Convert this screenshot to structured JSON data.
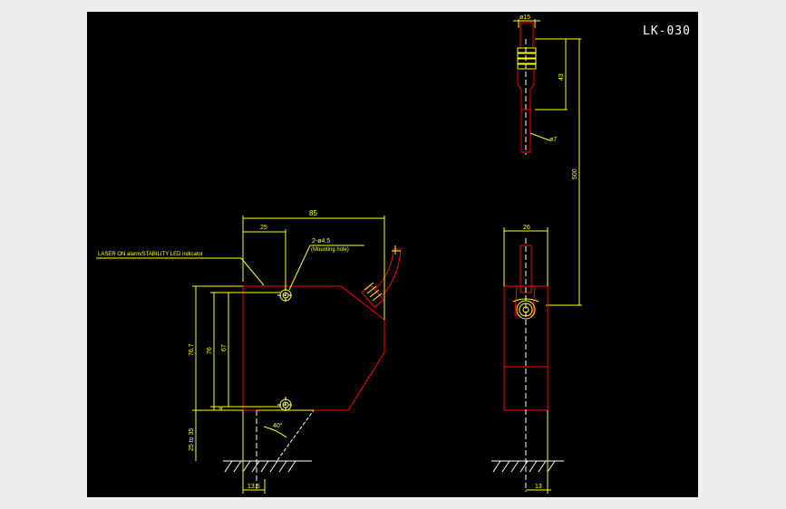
{
  "title": "LK-030",
  "colors": {
    "background": "#000000",
    "outline": "#ff0000",
    "dimension": "#ffff00",
    "centerline": "#ffffff",
    "frame": "#ededf0"
  },
  "front_view": {
    "dim_width": "85",
    "dim_hole_offset": "25",
    "mounting_hole_spec": "2-ø4.5",
    "mounting_hole_note": "(Mounting hole)",
    "led_indicator_note": "LASER ON alarm/STABILITY LED indicator",
    "dim_total_height": "76.7",
    "dim_body_height": "76",
    "dim_hole_pitch": "67",
    "dim_small": "4",
    "dim_range": "25 to 35",
    "angle": "40°",
    "dim_base": "13.5"
  },
  "side_view": {
    "dim_connector_dia": "ø15",
    "dim_connector_len": "43",
    "dim_cable_dia": "ø7",
    "dim_cable_len": "500",
    "dim_width": "26",
    "dim_base": "13"
  }
}
